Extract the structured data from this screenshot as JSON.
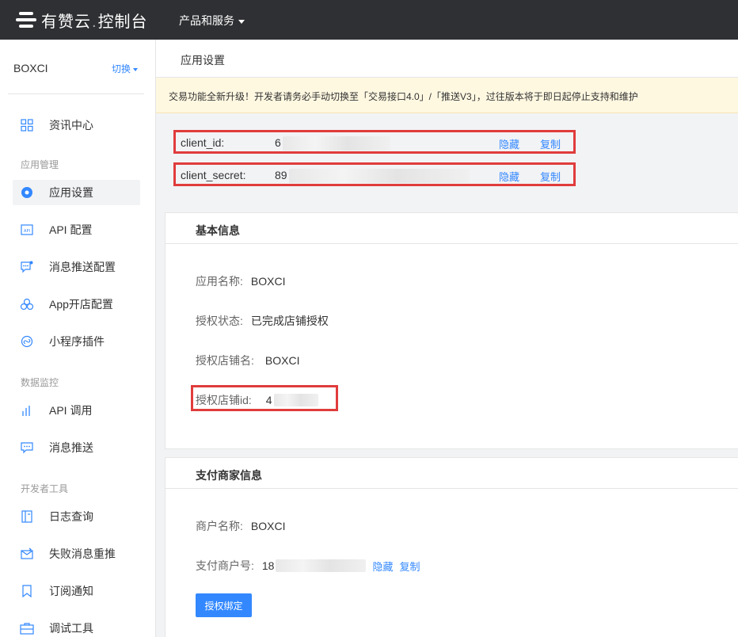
{
  "topbar": {
    "logo_brand": "有赞云",
    "logo_dot": ".",
    "logo_suffix": "控制台",
    "products_label": "产品和服务"
  },
  "sidebar": {
    "team_name": "BOXCI",
    "switch_label": "切换",
    "groups": {
      "app_manage": "应用管理",
      "data_monitor": "数据监控",
      "dev_tools": "开发者工具"
    },
    "items": [
      {
        "label": "资讯中心",
        "icon": "grid-icon"
      },
      {
        "label": "应用设置",
        "icon": "gear-icon",
        "active": true
      },
      {
        "label": "API 配置",
        "icon": "api-icon"
      },
      {
        "label": "消息推送配置",
        "icon": "message-config-icon"
      },
      {
        "label": "App开店配置",
        "icon": "app-store-icon"
      },
      {
        "label": "小程序插件",
        "icon": "plugin-icon"
      },
      {
        "label": "API 调用",
        "icon": "bar-chart-icon"
      },
      {
        "label": "消息推送",
        "icon": "message-icon"
      },
      {
        "label": "日志查询",
        "icon": "log-icon"
      },
      {
        "label": "失败消息重推",
        "icon": "mail-retry-icon"
      },
      {
        "label": "订阅通知",
        "icon": "bookmark-icon"
      },
      {
        "label": "调试工具",
        "icon": "toolbox-icon"
      }
    ]
  },
  "main": {
    "page_title": "应用设置",
    "notice": "交易功能全新升级！开发者请务必手动切换至「交易接口4.0」/「推送V3」，过往版本将于即日起停止支持和维护",
    "credentials": {
      "client_id_label": "client_id:",
      "client_id_value": "6",
      "client_secret_label": "client_secret:",
      "client_secret_value": "89",
      "hide_label": "隐藏",
      "copy_label": "复制"
    },
    "basic_info": {
      "title": "基本信息",
      "app_name_key": "应用名称:",
      "app_name_value": "BOXCI",
      "auth_status_key": "授权状态:",
      "auth_status_value": "已完成店铺授权",
      "shop_name_key": "授权店铺名:",
      "shop_name_value": "BOXCI",
      "shop_id_key": "授权店铺id:",
      "shop_id_value": "4"
    },
    "payment_info": {
      "title": "支付商家信息",
      "merchant_name_key": "商户名称:",
      "merchant_name_value": "BOXCI",
      "merchant_no_key": "支付商户号:",
      "merchant_no_value": "18",
      "hide_label": "隐藏",
      "copy_label": "复制",
      "bind_button": "授权绑定"
    }
  },
  "colors": {
    "topbar_bg": "#2f3033",
    "accent": "#3388ff",
    "highlight_border": "#e03c3c",
    "notice_bg": "#fff8e1"
  }
}
